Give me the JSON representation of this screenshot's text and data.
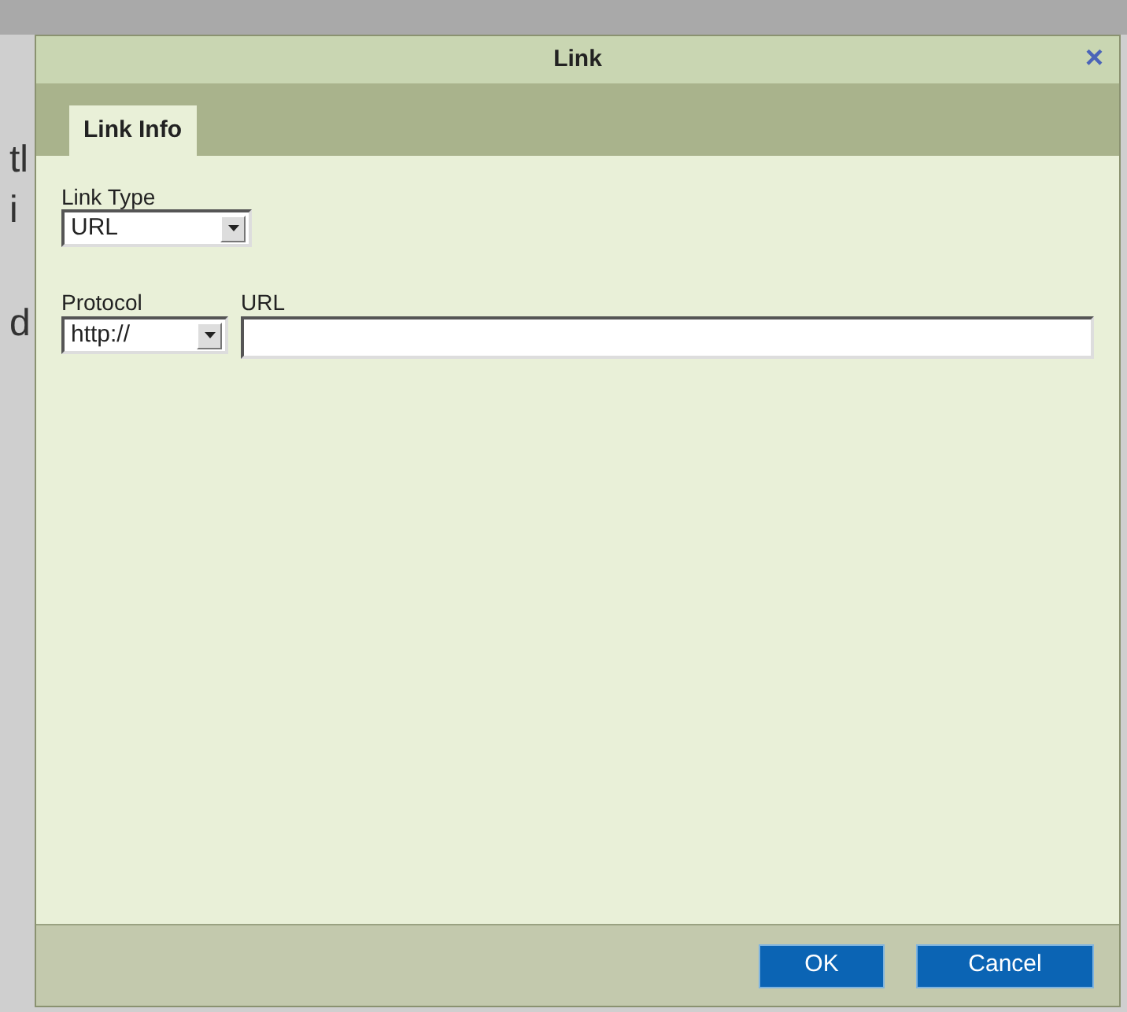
{
  "background_text": [
    "tl",
    "i",
    "d"
  ],
  "dialog": {
    "title": "Link",
    "close": "×"
  },
  "tabs": [
    {
      "label": "Link Info",
      "selected": true
    }
  ],
  "link_type": {
    "label": "Link Type",
    "value": "URL"
  },
  "protocol": {
    "label": "Protocol",
    "value": "http://"
  },
  "url": {
    "label": "URL"
  },
  "buttons": [
    "OK",
    "Cancel"
  ]
}
